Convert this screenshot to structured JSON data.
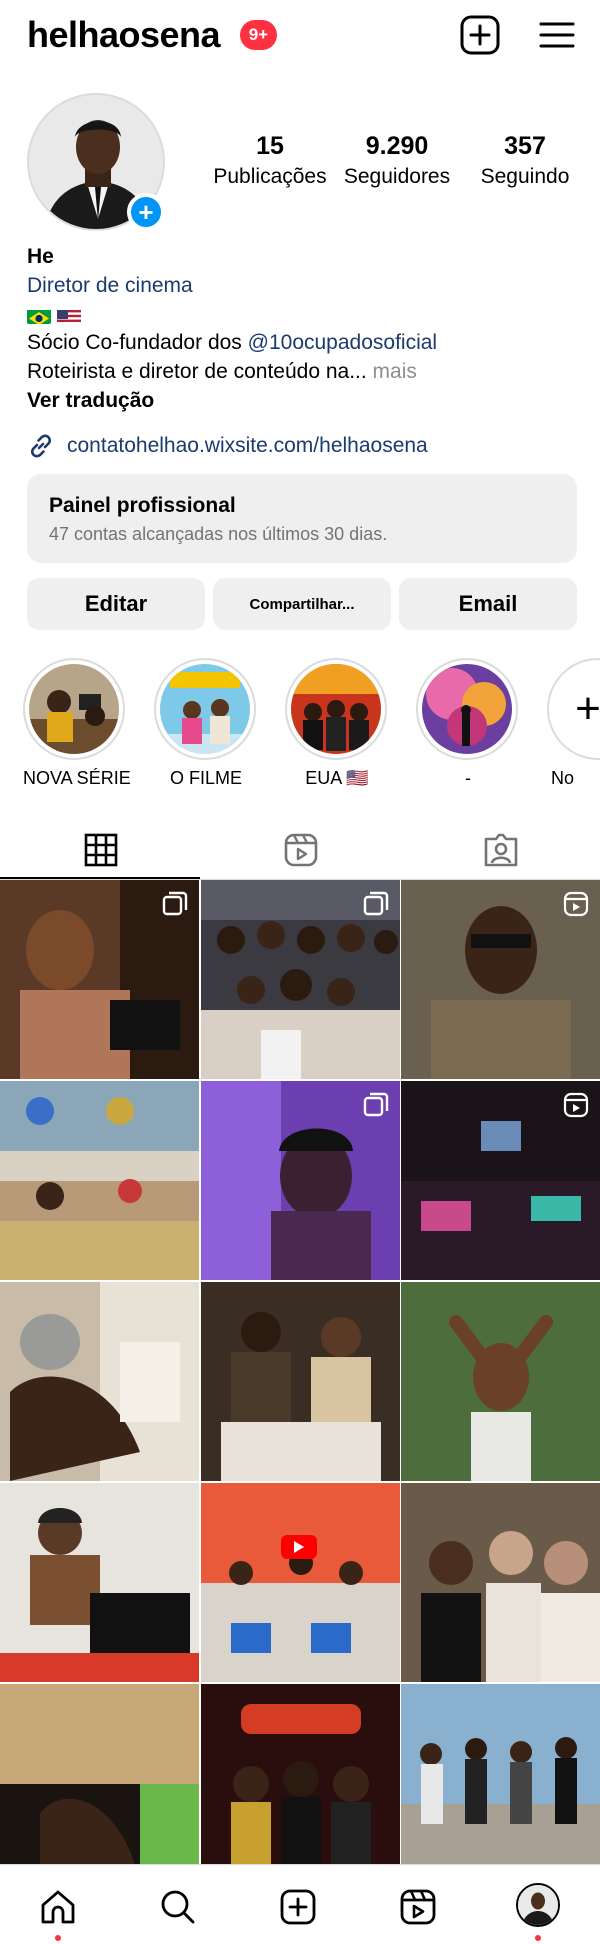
{
  "profile": {
    "username": "helhaosena",
    "notifications": "9+",
    "stats": [
      {
        "value": "15",
        "label": "Publicações"
      },
      {
        "value": "9.290",
        "label": "Seguidores"
      },
      {
        "value": "357",
        "label": "Seguindo"
      }
    ],
    "name": "He",
    "category": "Diretor de cinema",
    "bio_line1_prefix": "Sócio Co-fundador dos ",
    "bio_mention": "@10ocupadosoficial",
    "bio_line2": "Roteirista e diretor de conteúdo na...",
    "bio_more": " mais",
    "translate": "Ver tradução",
    "link": "contatohelhao.wixsite.com/helhaosena"
  },
  "pro_panel": {
    "title": "Painel profissional",
    "subtitle": "47 contas alcançadas nos últimos 30 dias."
  },
  "buttons": {
    "edit": "Editar",
    "share": "Compartilhar...",
    "email": "Email"
  },
  "highlights": [
    {
      "label": "NOVA SÉRIE"
    },
    {
      "label": "O FILME"
    },
    {
      "label": "EUA 🇺🇸"
    },
    {
      "label": "-"
    },
    {
      "label": "No"
    }
  ],
  "colors": {
    "accent": "#0095f6",
    "badge": "#ff3040",
    "link": "#1b3a6e"
  },
  "icons": {
    "header": [
      "add-post-icon",
      "menu-icon"
    ],
    "tabs": [
      "grid-icon",
      "reels-icon",
      "tagged-icon"
    ],
    "nav": [
      "home-icon",
      "search-icon",
      "create-icon",
      "reels-icon",
      "profile-avatar"
    ]
  }
}
